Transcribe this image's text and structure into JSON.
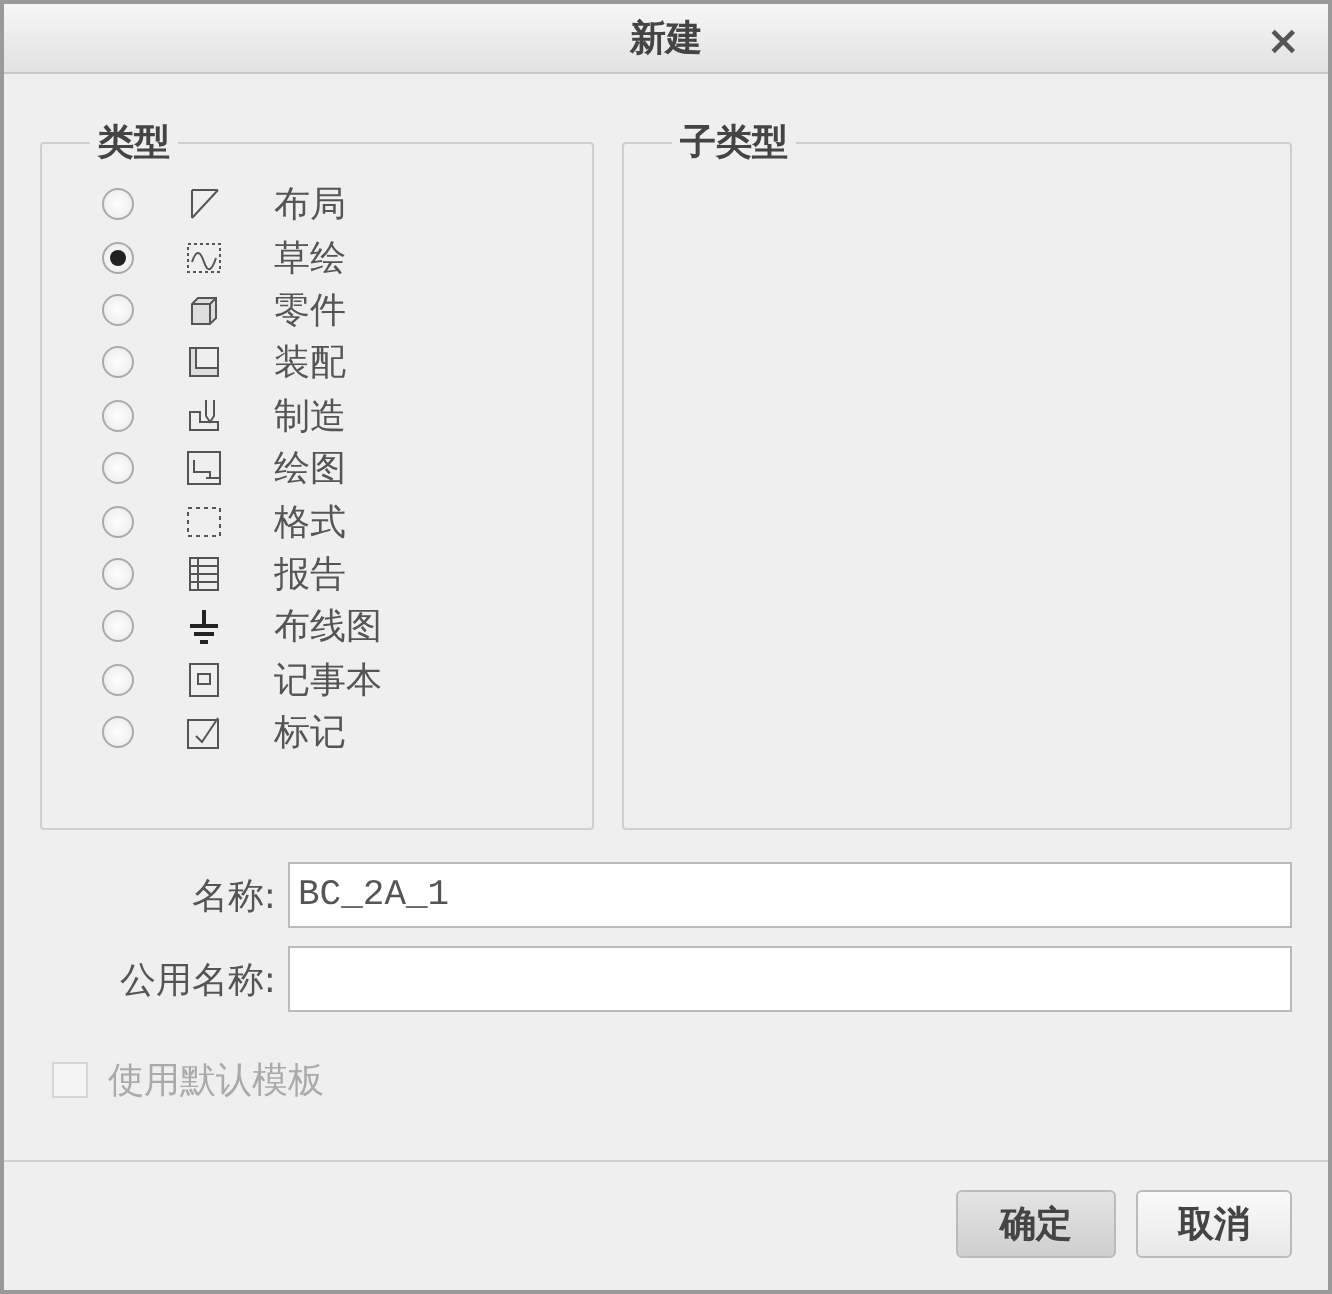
{
  "window": {
    "title": "新建",
    "close": "×"
  },
  "type_group": {
    "title": "类型",
    "items": [
      {
        "label": "布局",
        "selected": false
      },
      {
        "label": "草绘",
        "selected": true
      },
      {
        "label": "零件",
        "selected": false
      },
      {
        "label": "装配",
        "selected": false
      },
      {
        "label": "制造",
        "selected": false
      },
      {
        "label": "绘图",
        "selected": false
      },
      {
        "label": "格式",
        "selected": false
      },
      {
        "label": "报告",
        "selected": false
      },
      {
        "label": "布线图",
        "selected": false
      },
      {
        "label": "记事本",
        "selected": false
      },
      {
        "label": "标记",
        "selected": false
      }
    ]
  },
  "subtype_group": {
    "title": "子类型"
  },
  "fields": [
    {
      "label": "名称:",
      "value": "BC_2A_1"
    },
    {
      "label": "公用名称:"
    }
  ],
  "default_template": {
    "label": "使用默认模板",
    "checked": false,
    "disabled": true
  },
  "buttons": [
    {
      "label": "确定",
      "primary": true
    },
    {
      "label": "取消",
      "primary": false
    }
  ]
}
